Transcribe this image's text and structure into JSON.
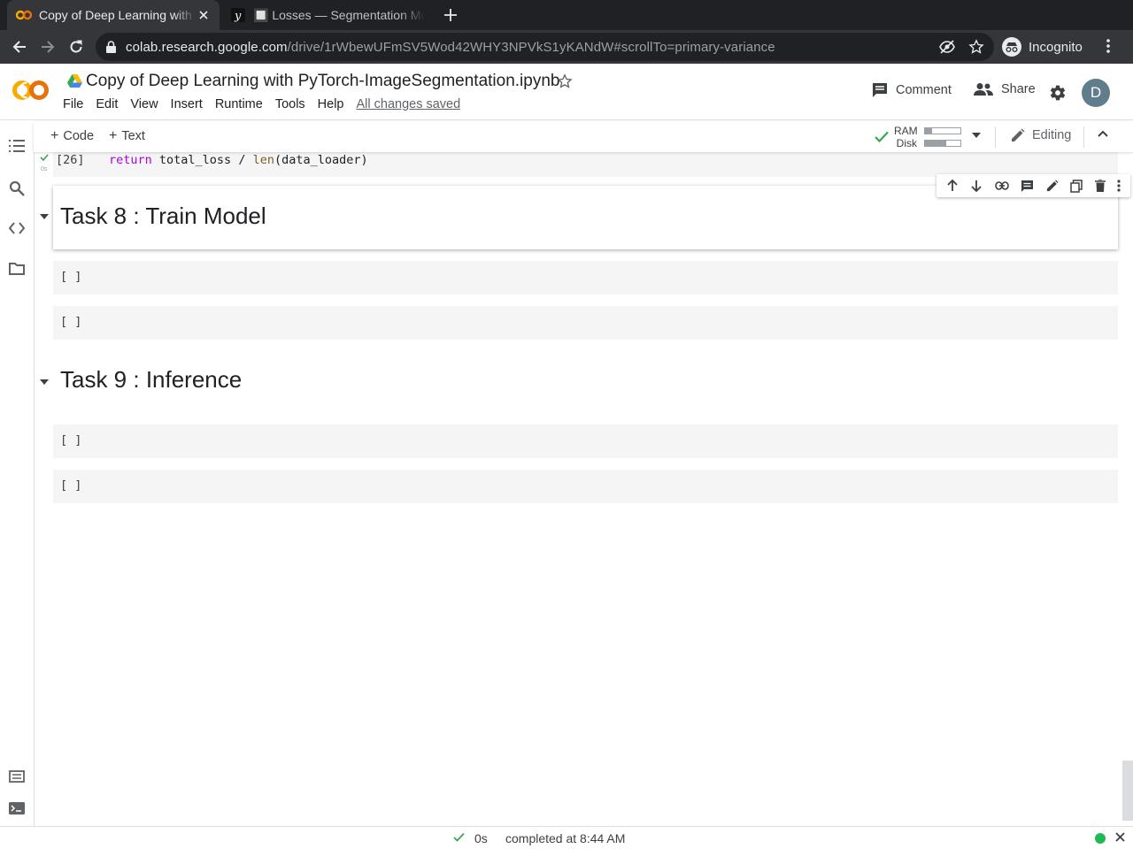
{
  "browser": {
    "tabs": [
      {
        "title": "Copy of Deep Learning with PyTorch",
        "active": true
      },
      {
        "title": "🔲 Losses — Segmentation Models",
        "active": false
      }
    ],
    "url_host": "colab.research.google.com",
    "url_path": "/drive/1rWbewUFmSV5Wod42WHY3NPVkS1yKANdW#scrollTo=primary-variance",
    "profile_label": "Incognito"
  },
  "colab": {
    "notebook_title": "Copy of Deep Learning with PyTorch-ImageSegmentation.ipynb",
    "menu": [
      "File",
      "Edit",
      "View",
      "Insert",
      "Runtime",
      "Tools",
      "Help"
    ],
    "save_status": "All changes saved",
    "comment_label": "Comment",
    "share_label": "Share",
    "user_initial": "D",
    "accent_color": "#f9ab00"
  },
  "toolbar": {
    "add_code_label": "Code",
    "add_text_label": "Text",
    "ram_label": "RAM",
    "disk_label": "Disk",
    "ram_usage": 0.2,
    "disk_usage": 0.6,
    "editing_label": "Editing"
  },
  "cells": {
    "prev_code": {
      "count": "[26]",
      "exec_time": "0s",
      "code_kw": "return",
      "code_mid": " total_loss / ",
      "code_fn": "len",
      "code_end": "(data_loader)"
    },
    "task8_heading": "Task 8 : Train Model",
    "task8_cell1": "[ ]",
    "task8_cell2": "[ ]",
    "task9_heading": "Task 9 : Inference",
    "task9_cell1": "[ ]",
    "task9_cell2": "[ ]"
  },
  "statusbar": {
    "duration": "0s",
    "message": "completed at 8:44 AM",
    "connected_color": "#1db954"
  }
}
